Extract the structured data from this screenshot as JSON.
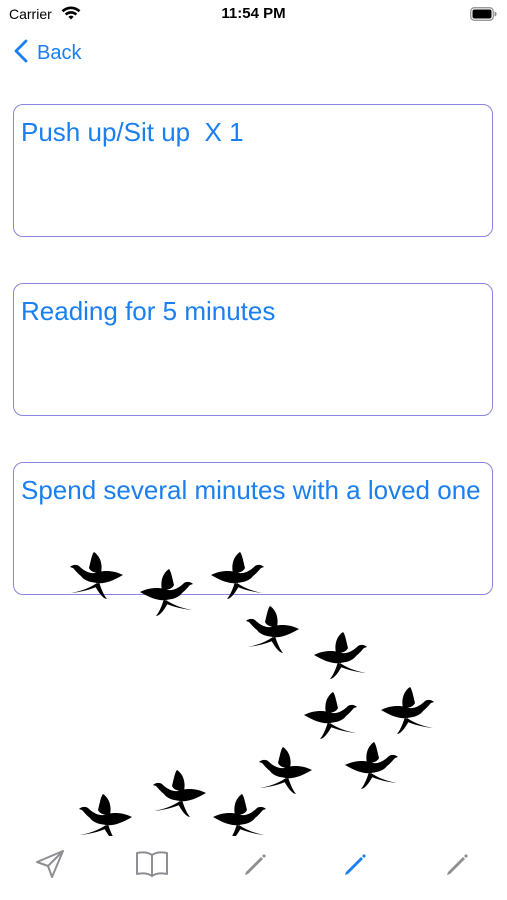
{
  "status_bar": {
    "carrier": "Carrier",
    "time": "11:54 PM",
    "wifi_icon": "wifi-icon",
    "battery_icon": "battery-icon"
  },
  "nav": {
    "back_label": "Back",
    "back_icon": "chevron-left-icon"
  },
  "tasks": [
    {
      "text": "Push up/Sit up  X 1"
    },
    {
      "text": "Reading for 5 minutes"
    },
    {
      "text": "Spend several minutes with a loved one"
    }
  ],
  "decoration": {
    "image": "flying-birds-flock",
    "bird_count": 12
  },
  "tab_bar": {
    "items": [
      {
        "icon": "paper-plane-icon",
        "selected": false
      },
      {
        "icon": "book-icon",
        "selected": false
      },
      {
        "icon": "pencil-icon",
        "selected": false
      },
      {
        "icon": "pencil-icon",
        "selected": true
      },
      {
        "icon": "pencil-icon",
        "selected": false
      }
    ]
  },
  "colors": {
    "accent": "#1a7ff0",
    "card_border": "#8b84e0",
    "tab_inactive": "#8e8e93"
  }
}
